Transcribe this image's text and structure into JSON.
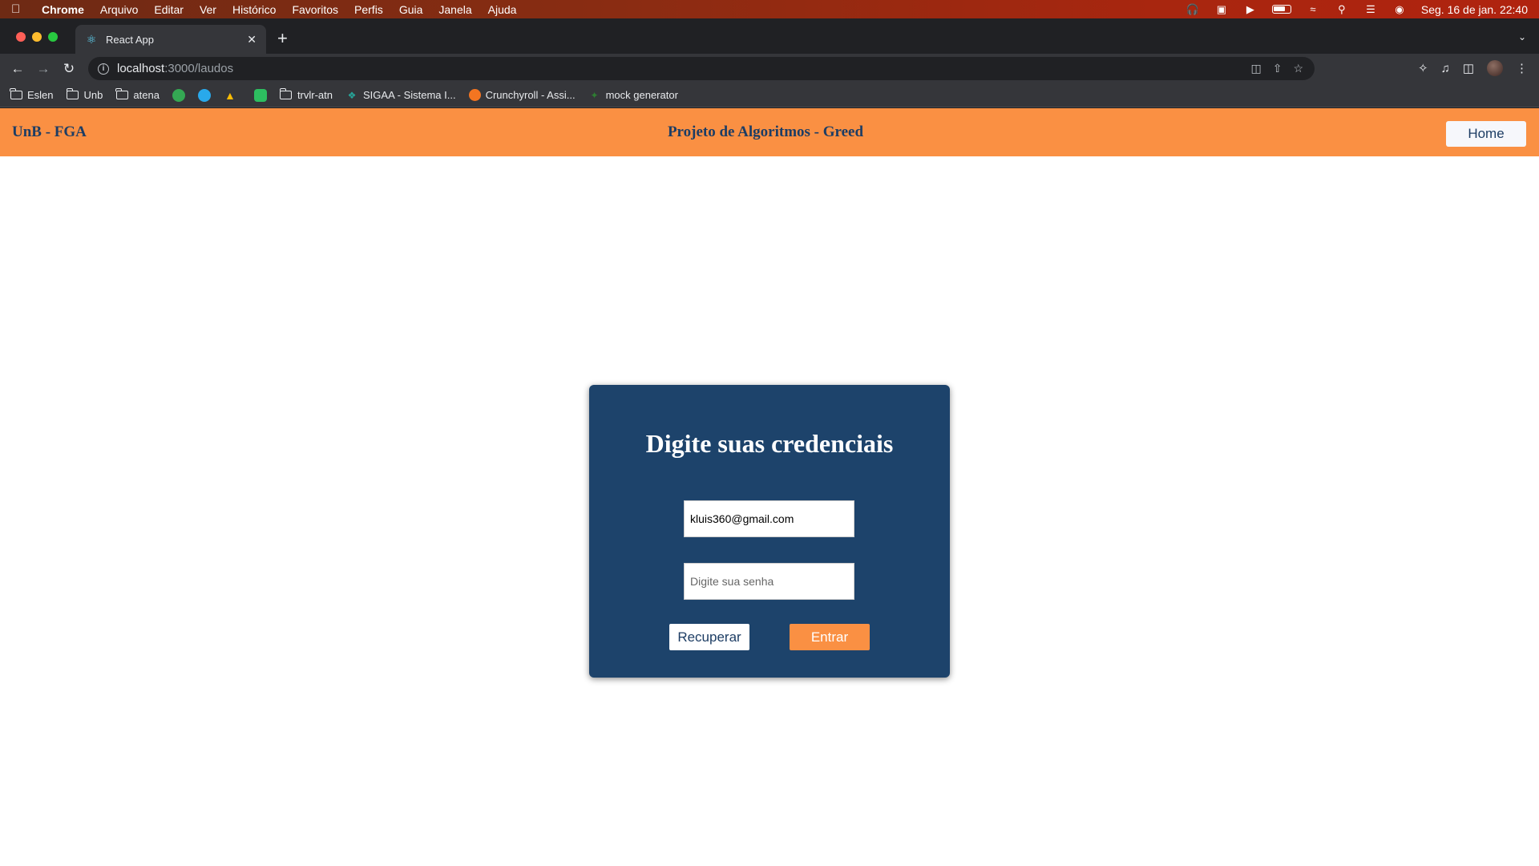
{
  "menubar": {
    "app": "Chrome",
    "items": [
      "Arquivo",
      "Editar",
      "Ver",
      "Histórico",
      "Favoritos",
      "Perfis",
      "Guia",
      "Janela",
      "Ajuda"
    ],
    "clock": "Seg. 16 de jan.  22:40"
  },
  "browser": {
    "tab_title": "React App",
    "url_host": "localhost",
    "url_path": ":3000/laudos"
  },
  "bookmarks": [
    "Eslen",
    "Unb",
    "atena",
    "trvlr-atn",
    "SIGAA - Sistema I...",
    "Crunchyroll - Assi...",
    "mock generator"
  ],
  "header": {
    "brand": "UnB - FGA",
    "title": "Projeto de Algoritmos - Greed",
    "home_label": "Home"
  },
  "login": {
    "heading": "Digite suas credenciais",
    "email_value": "kluis360@gmail.com",
    "password_placeholder": "Digite sua senha",
    "recover_label": "Recuperar",
    "enter_label": "Entrar"
  },
  "colors": {
    "header_bg": "#fa9043",
    "card_bg": "#1d436b",
    "text_navy": "#1d3d64"
  }
}
